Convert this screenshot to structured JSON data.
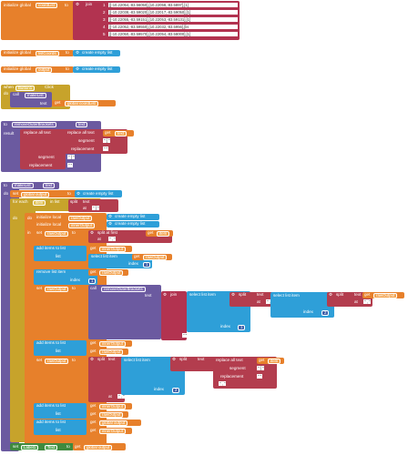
{
  "block1": {
    "initialize_global": "initialize global",
    "var_name": "coordList",
    "to": "to",
    "join": "join",
    "rows": [
      {
        "n": "1",
        "value": "[[-10.22054,-83.56050],[10.22058,-83.5897],[1]"
      },
      {
        "n": "2",
        "value": "[[-10.22038,-83.59020],[10.22017,-83.59050],[1]"
      },
      {
        "n": "3",
        "value": "[[-10.22055,-83.59151],[10.22053,-83.59131],[1]"
      },
      {
        "n": "4",
        "value": "[[-10.22052,-83.59550],[10.22032,-83.5956],[lis"
      },
      {
        "n": "5",
        "value": "[[-10.22050,-83.59570],[10.22054,-83.58000],[1]"
      }
    ]
  },
  "block2": {
    "initialize_global": "initialize global",
    "var_name": "listCoords",
    "to": "to",
    "create_empty_list": "create empty list"
  },
  "block3": {
    "initialize_global": "initialize global",
    "var_name": "output",
    "to": "to",
    "create_empty_list": "create empty list"
  },
  "block4": {
    "when": "when",
    "component": "Button1",
    "event": "Click",
    "do": "do",
    "call": "call",
    "proc": "makeList",
    "arg": "text",
    "get": "get",
    "get_var": "global coordList"
  },
  "block5": {
    "to": "to",
    "proc": "removeOuterBrackets",
    "param": "text",
    "result": "result",
    "replace_all_text": "replace all text",
    "text": "text",
    "segment": "segment",
    "replacement": "replacement",
    "get": "get",
    "get_var": "text",
    "seg1": "\" [ \"",
    "rep1": "\" \"",
    "seg2": "\" ] \"",
    "rep2": "\" \""
  },
  "block6": {
    "to": "to",
    "proc": "makeList",
    "param": "text",
    "do": "do",
    "set": "set",
    "to_kw": "to",
    "output_var": "global output",
    "create_empty_list": "create empty list",
    "for_each": "for each",
    "item": "item",
    "in_list": "in list",
    "split": "split",
    "at": "at",
    "at_val": "\" ] \"",
    "initialize_local": "initialize local",
    "rawOutput": "rawOutput",
    "innerOutput": "innerOutput",
    "in": "in",
    "split_at_first": "split at first",
    "comma": "\" , \"",
    "add_items_to_list": "add items to list",
    "list": "list",
    "select_list_item": "select list item",
    "index": "index",
    "one": "1",
    "two": "2",
    "remove_list_item": "remove list item",
    "call": "call",
    "removeOuterBrackets": "removeOuterBrackets",
    "join": "join",
    "replace_all_text": "replace all text",
    "segment": "segment",
    "replacement": "replacement",
    "get": "get",
    "get_item": "item",
    "get_text": "text",
    "get_raw": "rawOutput",
    "get_inner": "innerOutput",
    "get_output": "global output",
    "label": "Label1",
    "label_prop": "Text",
    "blank": "\" \""
  },
  "colors": {
    "variable": "#e7802b",
    "list": "#7b5ca4",
    "control": "#c7a32b",
    "procedure": "#6b5aa0",
    "text": "#b33d4e",
    "list_create": "#2e9fd8",
    "math": "#3c5ea8",
    "component": "#3f8a3e"
  }
}
